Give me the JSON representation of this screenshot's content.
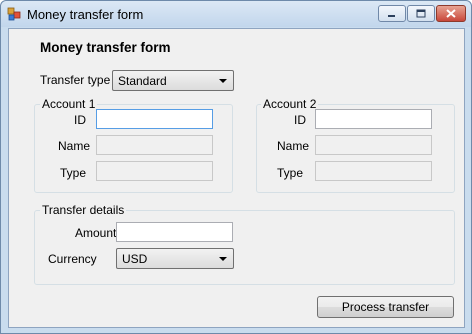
{
  "window": {
    "title": "Money transfer form"
  },
  "form": {
    "heading": "Money transfer form",
    "transfer_type": {
      "label": "Transfer type",
      "selected": "Standard"
    },
    "account1": {
      "group_label": "Account 1",
      "id_label": "ID",
      "id_value": "",
      "name_label": "Name",
      "name_value": "",
      "type_label": "Type",
      "type_value": ""
    },
    "account2": {
      "group_label": "Account 2",
      "id_label": "ID",
      "id_value": "",
      "name_label": "Name",
      "name_value": "",
      "type_label": "Type",
      "type_value": ""
    },
    "transfer_details": {
      "group_label": "Transfer details",
      "amount_label": "Amount",
      "amount_value": "",
      "currency_label": "Currency",
      "currency_selected": "USD"
    },
    "process_button_label": "Process transfer"
  }
}
